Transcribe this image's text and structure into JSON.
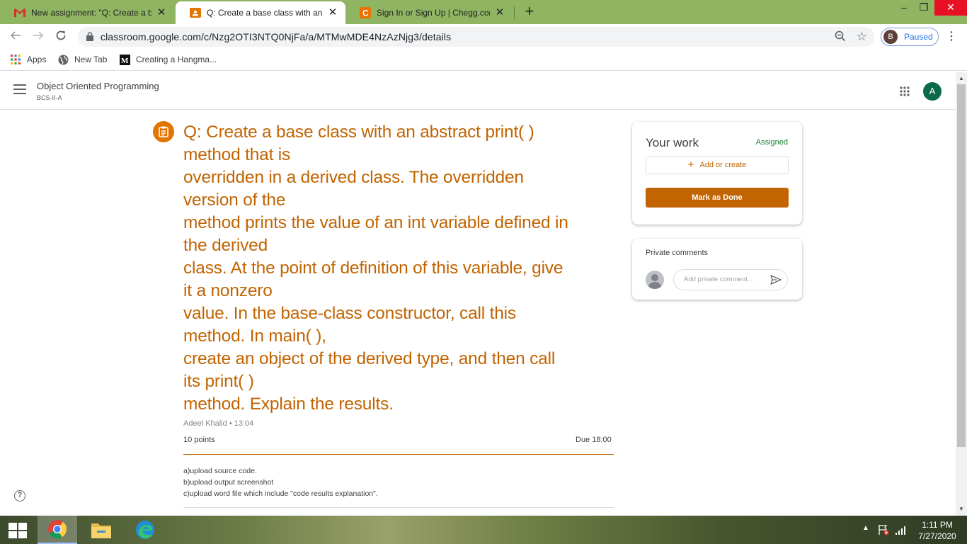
{
  "browser": {
    "tabs": [
      {
        "title": "New assignment: \"Q: Create a ba",
        "icon": "gmail-icon"
      },
      {
        "title": "Q: Create a base class with an ab",
        "icon": "classroom-icon"
      },
      {
        "title": "Sign In or Sign Up | Chegg.com",
        "icon": "chegg-icon"
      }
    ],
    "url": "classroom.google.com/c/Nzg2OTI3NTQ0NjFa/a/MTMwMDE4NzAzNjg3/details",
    "profile_initial": "B",
    "profile_status": "Paused",
    "bookmarks": [
      {
        "label": "Apps",
        "icon": "apps-grid-icon"
      },
      {
        "label": "New Tab",
        "icon": "globe-icon"
      },
      {
        "label": "Creating a Hangma...",
        "icon": "medium-logo-icon"
      }
    ],
    "colors": {
      "tabstrip": "#8fb563",
      "accent": "#1a73e8"
    }
  },
  "classroom": {
    "course_title": "Object Oriented Programming",
    "course_section": "BCS-II-A",
    "user_initial": "A",
    "theme_color": "#c26401"
  },
  "assignment": {
    "question": "Q: Create a base class with an abstract print( )\nmethod that is\noverridden in a derived class. The overridden\nversion of the\nmethod prints the value of an int variable defined in\nthe derived\nclass. At the point of definition of this variable, give\nit a nonzero\nvalue. In the base-class constructor, call this\nmethod. In main( ),\ncreate an object of the derived type, and then call\nits print( )\nmethod. Explain the results.",
    "author_time": "Adeel Khalid • 13:04",
    "points": "10 points",
    "due": "Due 18:00",
    "instructions": [
      "a)upload source code.",
      "b)upload output screenshot",
      "c)upload word file which include \"code results explanation\"."
    ]
  },
  "your_work": {
    "title": "Your work",
    "status": "Assigned",
    "add_label": "Add or create",
    "done_label": "Mark as Done"
  },
  "private_comments": {
    "title": "Private comments",
    "placeholder": "Add private comment..."
  },
  "taskbar": {
    "time": "1:11 PM",
    "date": "7/27/2020"
  }
}
